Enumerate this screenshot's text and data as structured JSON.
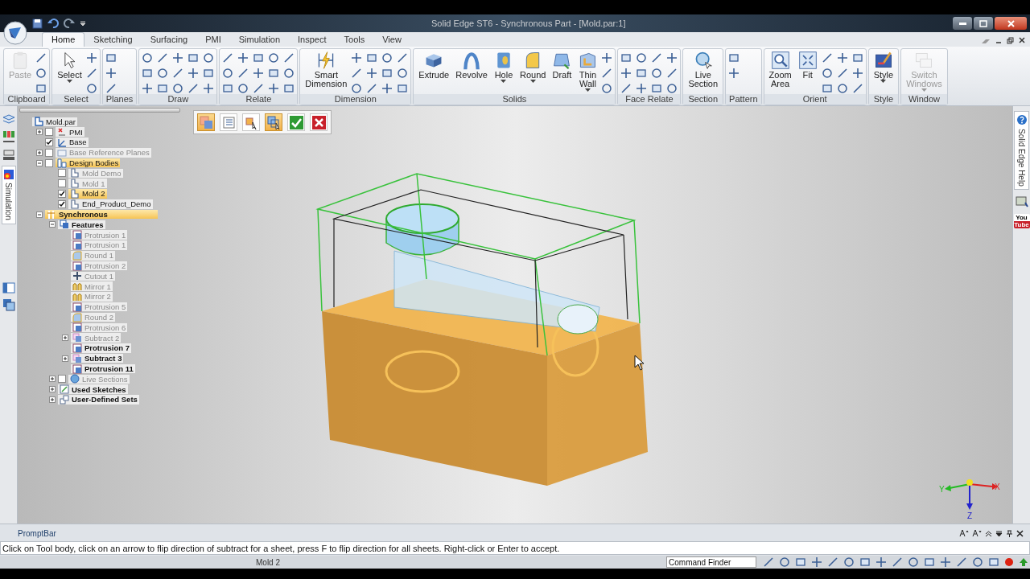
{
  "window": {
    "title": "Solid Edge ST6 - Synchronous Part - [Mold.par:1]"
  },
  "tabs": [
    {
      "label": "Home",
      "selected": true
    },
    {
      "label": "Sketching",
      "selected": false
    },
    {
      "label": "Surfacing",
      "selected": false
    },
    {
      "label": "PMI",
      "selected": false
    },
    {
      "label": "Simulation",
      "selected": false
    },
    {
      "label": "Inspect",
      "selected": false
    },
    {
      "label": "Tools",
      "selected": false
    },
    {
      "label": "View",
      "selected": false
    }
  ],
  "ribbon": [
    {
      "label": "Clipboard",
      "buttons": [
        {
          "label": "Paste",
          "disabled": true,
          "dropdown": false
        }
      ]
    },
    {
      "label": "Select",
      "buttons": [
        {
          "label": "Select",
          "disabled": false,
          "dropdown": true
        }
      ]
    },
    {
      "label": "Planes"
    },
    {
      "label": "Draw"
    },
    {
      "label": "Relate"
    },
    {
      "label": "Dimension",
      "buttons": [
        {
          "label": "Smart Dimension",
          "disabled": false,
          "dropdown": false
        }
      ]
    },
    {
      "label": "Solids",
      "buttons": [
        {
          "label": "Extrude",
          "disabled": false,
          "dropdown": false
        },
        {
          "label": "Revolve",
          "disabled": false,
          "dropdown": false
        },
        {
          "label": "Hole",
          "disabled": false,
          "dropdown": true
        },
        {
          "label": "Round",
          "disabled": false,
          "dropdown": true
        },
        {
          "label": "Draft",
          "disabled": false,
          "dropdown": false
        },
        {
          "label": "Thin Wall",
          "disabled": false,
          "dropdown": true
        }
      ]
    },
    {
      "label": "Face Relate"
    },
    {
      "label": "Section",
      "buttons": [
        {
          "label": "Live Section",
          "disabled": false,
          "dropdown": false
        }
      ]
    },
    {
      "label": "Pattern"
    },
    {
      "label": "Orient",
      "buttons": [
        {
          "label": "Zoom Area",
          "disabled": false,
          "dropdown": false
        },
        {
          "label": "Fit",
          "disabled": false,
          "dropdown": false
        }
      ]
    },
    {
      "label": "Style",
      "buttons": [
        {
          "label": "Style",
          "disabled": false,
          "dropdown": true
        }
      ]
    },
    {
      "label": "Window",
      "buttons": [
        {
          "label": "Switch Windows",
          "disabled": true,
          "dropdown": true
        }
      ]
    }
  ],
  "left_panel": {
    "simulation_tab": "Simulation"
  },
  "tree": {
    "label": "Mold.par",
    "kind": "part",
    "selected": false,
    "dimmed": false,
    "bold": false,
    "children": [
      {
        "label": "PMI",
        "kind": "pmi",
        "expanded": false,
        "checked": false,
        "selected": false,
        "dimmed": false,
        "bold": false
      },
      {
        "label": "Base",
        "kind": "coordinates",
        "checked": true,
        "selected": false,
        "dimmed": false,
        "bold": false
      },
      {
        "label": "Base Reference Planes",
        "kind": "planes",
        "expanded": false,
        "checked": false,
        "selected": false,
        "dimmed": true,
        "bold": false
      },
      {
        "label": "Design Bodies",
        "kind": "bodies",
        "expanded": true,
        "checked": false,
        "selected": true,
        "dimmed": false,
        "bold": false,
        "children": [
          {
            "label": "Mold Demo",
            "kind": "body",
            "checked": false,
            "selected": false,
            "dimmed": true,
            "bold": false
          },
          {
            "label": "Mold 1",
            "kind": "body",
            "checked": false,
            "selected": false,
            "dimmed": true,
            "bold": false
          },
          {
            "label": "Mold 2",
            "kind": "body",
            "checked": true,
            "selected": true,
            "dimmed": false,
            "bold": false
          },
          {
            "label": "End_Product_Demo",
            "kind": "body",
            "checked": true,
            "selected": false,
            "dimmed": false,
            "bold": false
          }
        ]
      },
      {
        "label": "Synchronous",
        "kind": "synchronous",
        "expanded": true,
        "selected": true,
        "dimmed": false,
        "bold": true,
        "children": [
          {
            "label": "Features",
            "kind": "features",
            "expanded": true,
            "selected": false,
            "dimmed": false,
            "bold": true,
            "children": [
              {
                "label": "Protrusion 1",
                "kind": "protrusion",
                "selected": false,
                "dimmed": true,
                "bold": false
              },
              {
                "label": "Protrusion 1",
                "kind": "protrusion",
                "selected": false,
                "dimmed": true,
                "bold": false
              },
              {
                "label": "Round 1",
                "kind": "round",
                "selected": false,
                "dimmed": true,
                "bold": false
              },
              {
                "label": "Protrusion 2",
                "kind": "protrusion",
                "selected": false,
                "dimmed": true,
                "bold": false
              },
              {
                "label": "Cutout 1",
                "kind": "cutout",
                "selected": false,
                "dimmed": true,
                "bold": false
              },
              {
                "label": "Mirror 1",
                "kind": "mirror",
                "selected": false,
                "dimmed": true,
                "bold": false
              },
              {
                "label": "Mirror 2",
                "kind": "mirror",
                "selected": false,
                "dimmed": true,
                "bold": false
              },
              {
                "label": "Protrusion 5",
                "kind": "protrusion",
                "selected": false,
                "dimmed": true,
                "bold": false
              },
              {
                "label": "Round 2",
                "kind": "round",
                "selected": false,
                "dimmed": true,
                "bold": false
              },
              {
                "label": "Protrusion 6",
                "kind": "protrusion",
                "selected": false,
                "dimmed": true,
                "bold": false
              },
              {
                "label": "Subtract 2",
                "kind": "subtract",
                "expanded": false,
                "selected": false,
                "dimmed": true,
                "bold": false
              },
              {
                "label": "Protrusion 7",
                "kind": "protrusion",
                "selected": false,
                "dimmed": false,
                "bold": true
              },
              {
                "label": "Subtract 3",
                "kind": "subtract",
                "expanded": false,
                "selected": false,
                "dimmed": false,
                "bold": true
              },
              {
                "label": "Protrusion 11",
                "kind": "protrusion",
                "selected": false,
                "dimmed": false,
                "bold": true
              }
            ]
          },
          {
            "label": "Live Sections",
            "kind": "section",
            "expanded": false,
            "checked": false,
            "selected": false,
            "dimmed": true,
            "bold": false
          },
          {
            "label": "Used Sketches",
            "kind": "sketch",
            "expanded": false,
            "selected": false,
            "dimmed": false,
            "bold": true
          },
          {
            "label": "User-Defined Sets",
            "kind": "sets",
            "expanded": false,
            "selected": false,
            "dimmed": false,
            "bold": true
          }
        ]
      }
    ]
  },
  "command_bar": [
    {
      "kind": "body",
      "selected": true
    },
    {
      "kind": "list",
      "selected": false
    },
    {
      "kind": "pick",
      "selected": false
    },
    {
      "kind": "pick-body",
      "selected": true
    },
    {
      "kind": "accept",
      "selected": false
    },
    {
      "kind": "cancel",
      "selected": false
    }
  ],
  "triad": {
    "x": "X",
    "y": "Y",
    "z": "Z"
  },
  "right_panel": {
    "help_tab": "Solid Edge Help",
    "video_badge": [
      "You",
      "Tube"
    ]
  },
  "prompt_bar": {
    "title": "PromptBar",
    "message": "Click on Tool body, click on an arrow to flip direction of subtract for a sheet, press F to flip direction for all sheets.  Right-click or Enter to accept."
  },
  "status_bar": {
    "document": "Mold 2",
    "command_finder": {
      "placeholder": "Command Finder"
    }
  }
}
